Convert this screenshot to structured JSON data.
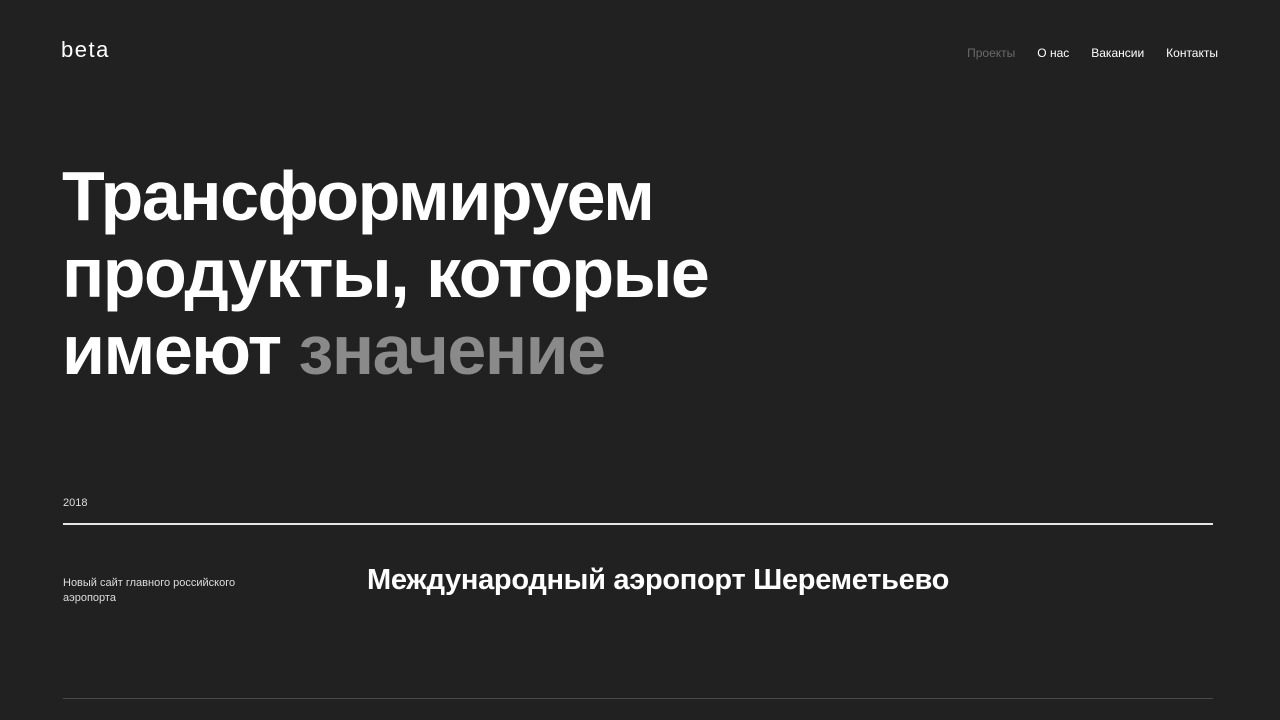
{
  "brand": {
    "logo": "beta"
  },
  "nav": {
    "items": [
      {
        "label": "Проекты",
        "active": false
      },
      {
        "label": "О нас",
        "active": true
      },
      {
        "label": "Вакансии",
        "active": true
      },
      {
        "label": "Контакты",
        "active": true
      }
    ]
  },
  "hero": {
    "line1": "Трансформируем",
    "line2": "продукты, которые",
    "line3_main": "имеют",
    "line3_accent": "значение"
  },
  "projects": {
    "year": "2018",
    "items": [
      {
        "description": "Новый сайт главного российского аэропорта",
        "title": "Международный аэропорт Шереметьево"
      }
    ]
  },
  "colors": {
    "background": "#212121",
    "text": "#ffffff",
    "accent_muted": "#8a8a8a",
    "nav_inactive": "#6a6a6a"
  }
}
